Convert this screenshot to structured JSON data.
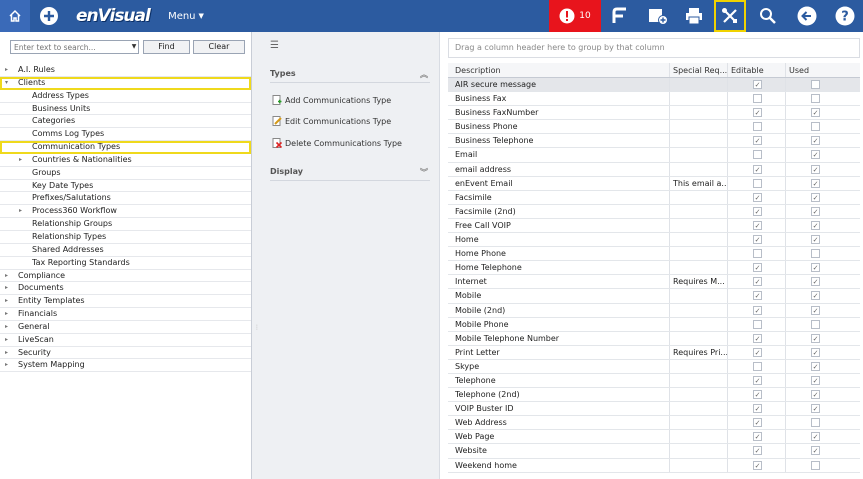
{
  "topbar": {
    "logo": "enVisual",
    "menu_label": "Menu",
    "alert_count": "10",
    "colors": {
      "bar": "#2c5ba0",
      "alert": "#e8141c",
      "highlight": "#f0d200"
    },
    "icons": [
      "home-icon",
      "plus-circle-icon",
      "menu-caret-icon",
      "alert-icon",
      "f-icon",
      "add-page-icon",
      "print-icon",
      "tools-icon",
      "search-icon",
      "back-icon",
      "help-icon"
    ]
  },
  "left": {
    "search_placeholder": "Enter text to search...",
    "find_label": "Find",
    "clear_label": "Clear",
    "tree": [
      {
        "label": "A.I. Rules",
        "level": 0,
        "arrow": "▸"
      },
      {
        "label": "Clients",
        "level": 0,
        "arrow": "▾",
        "selected": true
      },
      {
        "label": "Address Types",
        "level": 1
      },
      {
        "label": "Business Units",
        "level": 1
      },
      {
        "label": "Categories",
        "level": 1
      },
      {
        "label": "Comms Log Types",
        "level": 1
      },
      {
        "label": "Communication Types",
        "level": 1,
        "selected": true
      },
      {
        "label": "Countries & Nationalities",
        "level": 1,
        "arrow": "▸"
      },
      {
        "label": "Groups",
        "level": 1
      },
      {
        "label": "Key Date Types",
        "level": 1
      },
      {
        "label": "Prefixes/Salutations",
        "level": 1
      },
      {
        "label": "Process360 Workflow",
        "level": 1,
        "arrow": "▸"
      },
      {
        "label": "Relationship Groups",
        "level": 1
      },
      {
        "label": "Relationship Types",
        "level": 1
      },
      {
        "label": "Shared Addresses",
        "level": 1
      },
      {
        "label": "Tax Reporting Standards",
        "level": 1
      },
      {
        "label": "Compliance",
        "level": 0,
        "arrow": "▸"
      },
      {
        "label": "Documents",
        "level": 0,
        "arrow": "▸"
      },
      {
        "label": "Entity Templates",
        "level": 0,
        "arrow": "▸"
      },
      {
        "label": "Financials",
        "level": 0,
        "arrow": "▸"
      },
      {
        "label": "General",
        "level": 0,
        "arrow": "▸"
      },
      {
        "label": "LiveScan",
        "level": 0,
        "arrow": "▸"
      },
      {
        "label": "Security",
        "level": 0,
        "arrow": "▸"
      },
      {
        "label": "System Mapping",
        "level": 0,
        "arrow": "▸"
      }
    ]
  },
  "middle": {
    "types_header": "Types",
    "add_label": "Add Communications Type",
    "edit_label": "Edit Communications Type",
    "delete_label": "Delete Communications Type",
    "display_header": "Display"
  },
  "grid": {
    "group_hint": "Drag a column header here to group by that column",
    "columns": [
      "Description",
      "Special Req...",
      "Editable",
      "Used"
    ],
    "rows": [
      {
        "desc": "AIR secure message",
        "special": "",
        "editable": true,
        "used": false
      },
      {
        "desc": "Business Fax",
        "special": "",
        "editable": false,
        "used": false
      },
      {
        "desc": "Business FaxNumber",
        "special": "",
        "editable": true,
        "used": true
      },
      {
        "desc": "Business Phone",
        "special": "",
        "editable": false,
        "used": false
      },
      {
        "desc": "Business Telephone",
        "special": "",
        "editable": true,
        "used": true
      },
      {
        "desc": "Email",
        "special": "",
        "editable": false,
        "used": true
      },
      {
        "desc": "email address",
        "special": "",
        "editable": true,
        "used": true
      },
      {
        "desc": "enEvent Email",
        "special": "This email a...",
        "editable": false,
        "used": true
      },
      {
        "desc": "Facsimile",
        "special": "",
        "editable": true,
        "used": true
      },
      {
        "desc": "Facsimile (2nd)",
        "special": "",
        "editable": true,
        "used": true
      },
      {
        "desc": "Free Call VOIP",
        "special": "",
        "editable": true,
        "used": true
      },
      {
        "desc": "Home",
        "special": "",
        "editable": true,
        "used": true
      },
      {
        "desc": "Home Phone",
        "special": "",
        "editable": false,
        "used": false
      },
      {
        "desc": "Home Telephone",
        "special": "",
        "editable": true,
        "used": true
      },
      {
        "desc": "Internet",
        "special": "Requires M...",
        "editable": true,
        "used": true
      },
      {
        "desc": "Mobile",
        "special": "",
        "editable": true,
        "used": true
      },
      {
        "desc": "Mobile (2nd)",
        "special": "",
        "editable": true,
        "used": true
      },
      {
        "desc": "Mobile Phone",
        "special": "",
        "editable": false,
        "used": false
      },
      {
        "desc": "Mobile Telephone Number",
        "special": "",
        "editable": true,
        "used": true
      },
      {
        "desc": "Print Letter",
        "special": "Requires Pri...",
        "editable": true,
        "used": true
      },
      {
        "desc": "Skype",
        "special": "",
        "editable": false,
        "used": true
      },
      {
        "desc": "Telephone",
        "special": "",
        "editable": true,
        "used": true
      },
      {
        "desc": "Telephone (2nd)",
        "special": "",
        "editable": true,
        "used": true
      },
      {
        "desc": "VOIP Buster ID",
        "special": "",
        "editable": true,
        "used": true
      },
      {
        "desc": "Web Address",
        "special": "",
        "editable": true,
        "used": false
      },
      {
        "desc": "Web Page",
        "special": "",
        "editable": true,
        "used": true
      },
      {
        "desc": "Website",
        "special": "",
        "editable": true,
        "used": true
      },
      {
        "desc": "Weekend home",
        "special": "",
        "editable": true,
        "used": false
      }
    ]
  }
}
